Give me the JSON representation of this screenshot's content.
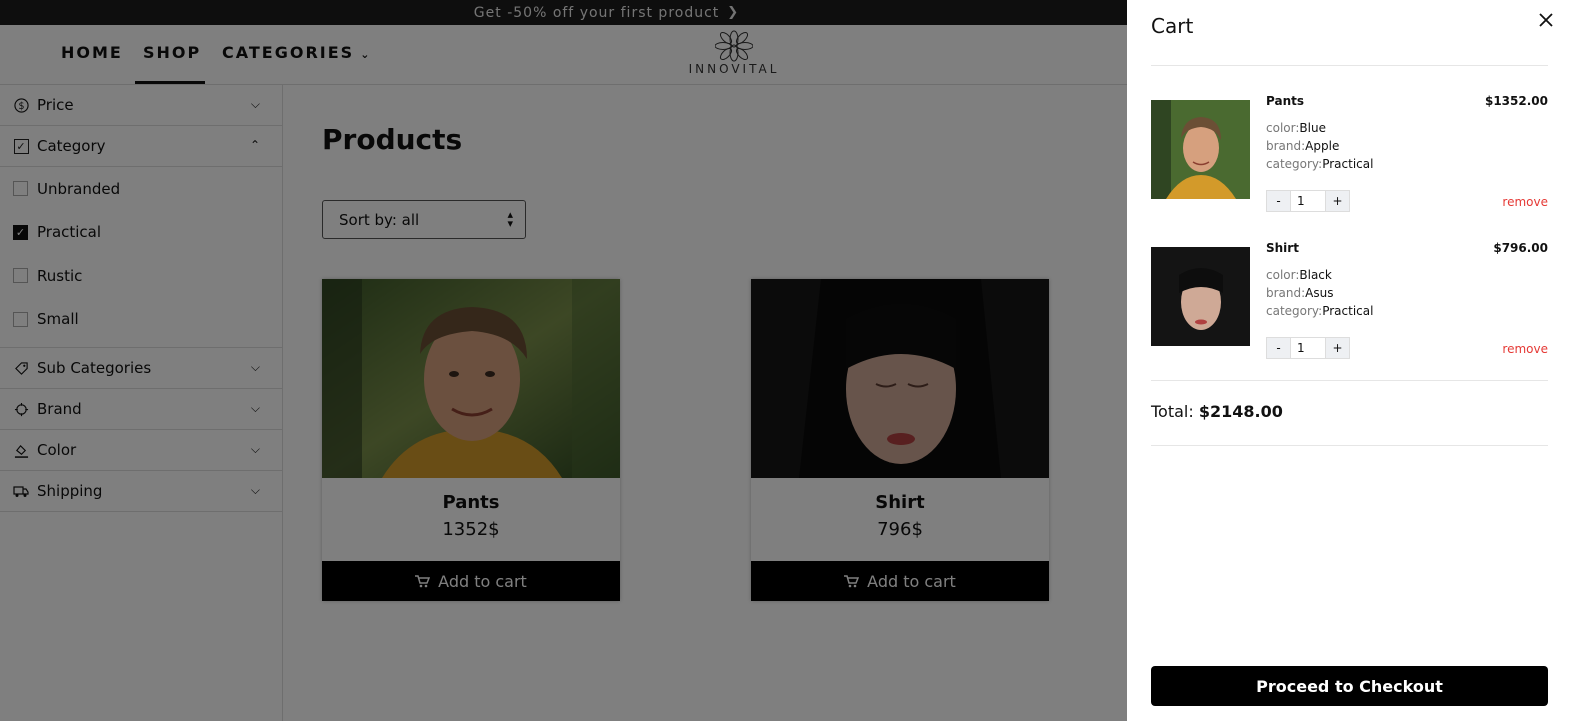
{
  "promo": {
    "text": "Get -50% off your first product"
  },
  "nav": {
    "home": "HOME",
    "shop": "SHOP",
    "categories": "CATEGORIES",
    "logo_text": "INNOVITAL"
  },
  "filters": {
    "price": "Price",
    "category": "Category",
    "category_options": [
      {
        "label": "Unbranded",
        "checked": false
      },
      {
        "label": "Practical",
        "checked": true
      },
      {
        "label": "Rustic",
        "checked": false
      },
      {
        "label": "Small",
        "checked": false
      }
    ],
    "sub_categories": "Sub Categories",
    "brand": "Brand",
    "color": "Color",
    "shipping": "Shipping"
  },
  "main": {
    "title": "Products",
    "sort_label": "Sort by: all"
  },
  "products": [
    {
      "name": "Pants",
      "price": "1352$",
      "button": "Add to cart"
    },
    {
      "name": "Shirt",
      "price": "796$",
      "button": "Add to cart"
    }
  ],
  "cart": {
    "title": "Cart",
    "items": [
      {
        "name": "Pants",
        "price": "$1352.00",
        "color_key": "color:",
        "color": "Blue",
        "brand_key": "brand:",
        "brand": "Apple",
        "category_key": "category:",
        "category": "Practical",
        "qty": "1",
        "minus": "-",
        "plus": "+",
        "remove": "remove"
      },
      {
        "name": "Shirt",
        "price": "$796.00",
        "color_key": "color:",
        "color": "Black",
        "brand_key": "brand:",
        "brand": "Asus",
        "category_key": "category:",
        "category": "Practical",
        "qty": "1",
        "minus": "-",
        "plus": "+",
        "remove": "remove"
      }
    ],
    "total_label": "Total:",
    "total_value": "$2148.00",
    "checkout": "Proceed to Checkout"
  },
  "colors": {
    "overlay": "rgba(0,0,0,0.5)",
    "remove": "#e53935",
    "button": "#000000"
  }
}
